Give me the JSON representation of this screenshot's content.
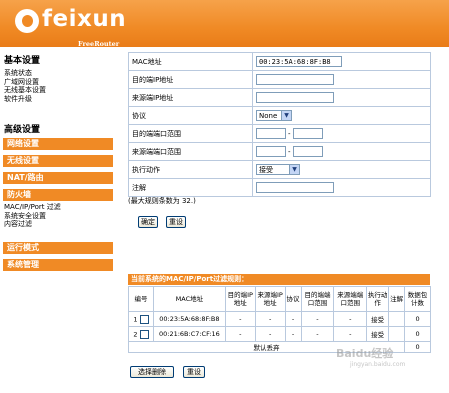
{
  "brand": {
    "logo_text": "feixun",
    "model": "FreeRouter 605"
  },
  "sidebar": {
    "basic_title": "基本设置",
    "basic_links": [
      "系统状态",
      "广域网设置",
      "无线基本设置",
      "软件升级"
    ],
    "advanced_title": "高级设置",
    "bars": {
      "network": "网络设置",
      "wireless": "无线设置",
      "nat": "NAT/路由",
      "firewall": "防火墙",
      "run_mode": "运行模式",
      "system": "系统管理"
    },
    "firewall_links": [
      "MAC/IP/Port 过滤",
      "系统安全设置",
      "内容过滤"
    ]
  },
  "form": {
    "mac_label": "MAC地址",
    "mac_value": "00:23:5A:68:8F:B8",
    "dst_ip_label": "目的端IP地址",
    "dst_ip_value": "",
    "src_ip_label": "来源端IP地址",
    "src_ip_value": "",
    "protocol_label": "协议",
    "protocol_value": "None",
    "dst_port_label": "目的端端口范围",
    "src_port_label": "来源端端口范围",
    "port_sep": "-",
    "action_label": "执行动作",
    "action_value": "接受",
    "comment_label": "注解",
    "comment_value": ""
  },
  "max_rules": "(最大规则条数为 32.)",
  "buttons": {
    "confirm": "确定",
    "reset": "重设",
    "delete_selected": "选择删除",
    "reset2": "重设"
  },
  "rules": {
    "title": "当前系统的MAC/IP/Port过滤规则：",
    "columns": [
      "编号",
      "MAC地址",
      "目的端IP地址",
      "来源端IP地址",
      "协议",
      "目的端端口范围",
      "来源端端口范围",
      "执行动作",
      "注解",
      "数据包计数"
    ],
    "rows": [
      {
        "no": "1",
        "mac": "00:23:5A:68:8F:B8",
        "dst_ip": "-",
        "src_ip": "-",
        "proto": "-",
        "dst_port": "-",
        "src_port": "-",
        "action": "接受",
        "comment": "",
        "count": "0"
      },
      {
        "no": "2",
        "mac": "00:21:6B:C7:CF:16",
        "dst_ip": "-",
        "src_ip": "-",
        "proto": "-",
        "dst_port": "-",
        "src_port": "-",
        "action": "接受",
        "comment": "",
        "count": "0"
      }
    ],
    "default_label": "默认丢弃",
    "default_count": "0"
  },
  "watermark": {
    "main": "Baidu经验",
    "sub": "jingyan.baidu.com"
  },
  "colors": {
    "accent": "#f08a25",
    "border": "#b9c9de"
  }
}
